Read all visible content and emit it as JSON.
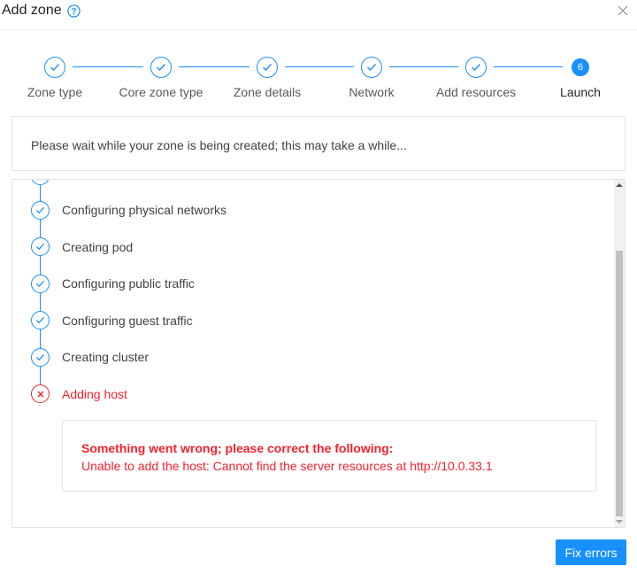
{
  "dialog": {
    "title": "Add zone",
    "icons": {
      "help": "question-circle-icon",
      "close": "close-icon"
    }
  },
  "steps": [
    {
      "label": "Zone type",
      "status": "done"
    },
    {
      "label": "Core zone type",
      "status": "done"
    },
    {
      "label": "Zone details",
      "status": "done"
    },
    {
      "label": "Network",
      "status": "done"
    },
    {
      "label": "Add resources",
      "status": "done"
    },
    {
      "label": "Launch",
      "status": "active",
      "number": "6"
    }
  ],
  "info": {
    "message": "Please wait while your zone is being created; this may take a while..."
  },
  "progress": {
    "items": [
      {
        "label": "Configuring physical networks",
        "status": "done"
      },
      {
        "label": "Creating pod",
        "status": "done"
      },
      {
        "label": "Configuring public traffic",
        "status": "done"
      },
      {
        "label": "Configuring guest traffic",
        "status": "done"
      },
      {
        "label": "Creating cluster",
        "status": "done"
      },
      {
        "label": "Adding host",
        "status": "error"
      }
    ],
    "error": {
      "heading": "Something went wrong; please correct the following:",
      "message": "Unable to add the host: Cannot find the server resources at http://10.0.33.1"
    }
  },
  "footer": {
    "fix_label": "Fix errors"
  },
  "colors": {
    "primary": "#1890ff",
    "error": "#f5222d",
    "border": "#e4e4e4"
  }
}
